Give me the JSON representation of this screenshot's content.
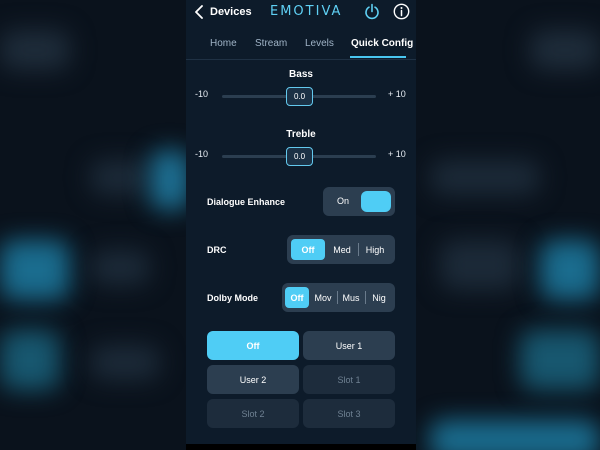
{
  "header": {
    "back_label": "Devices",
    "logo_text": "EMOTIVA",
    "back_icon": "chevron-left-icon",
    "power_icon": "power-icon",
    "info_icon": "info-icon"
  },
  "tabs": [
    {
      "label": "Home",
      "active": false
    },
    {
      "label": "Stream",
      "active": false
    },
    {
      "label": "Levels",
      "active": false
    },
    {
      "label": "Quick Config",
      "active": true
    }
  ],
  "bass": {
    "title": "Bass",
    "min_label": "-10",
    "max_label": "+ 10",
    "value": "0.0",
    "level": 0.5
  },
  "treble": {
    "title": "Treble",
    "min_label": "-10",
    "max_label": "+ 10",
    "value": "0.0",
    "level": 0.5
  },
  "dialogue": {
    "label": "Dialogue Enhance",
    "state_label": "On"
  },
  "drc": {
    "label": "DRC",
    "options": [
      "Off",
      "Med",
      "High"
    ],
    "selected": "Off"
  },
  "dolby": {
    "label": "Dolby Mode",
    "options": [
      "Off",
      "Mov",
      "Mus",
      "Nig"
    ],
    "selected": "Off"
  },
  "presets": [
    {
      "label": "Off",
      "state": "selected"
    },
    {
      "label": "User 1",
      "state": "enabled"
    },
    {
      "label": "User 2",
      "state": "enabled"
    },
    {
      "label": "Slot 1",
      "state": "disabled"
    },
    {
      "label": "Slot 2",
      "state": "disabled"
    },
    {
      "label": "Slot 3",
      "state": "disabled"
    }
  ],
  "colors": {
    "accent": "#4fcdf5",
    "panel": "#0d1b2a",
    "control": "#2c3e50",
    "disabled": "#1d2c3c"
  }
}
